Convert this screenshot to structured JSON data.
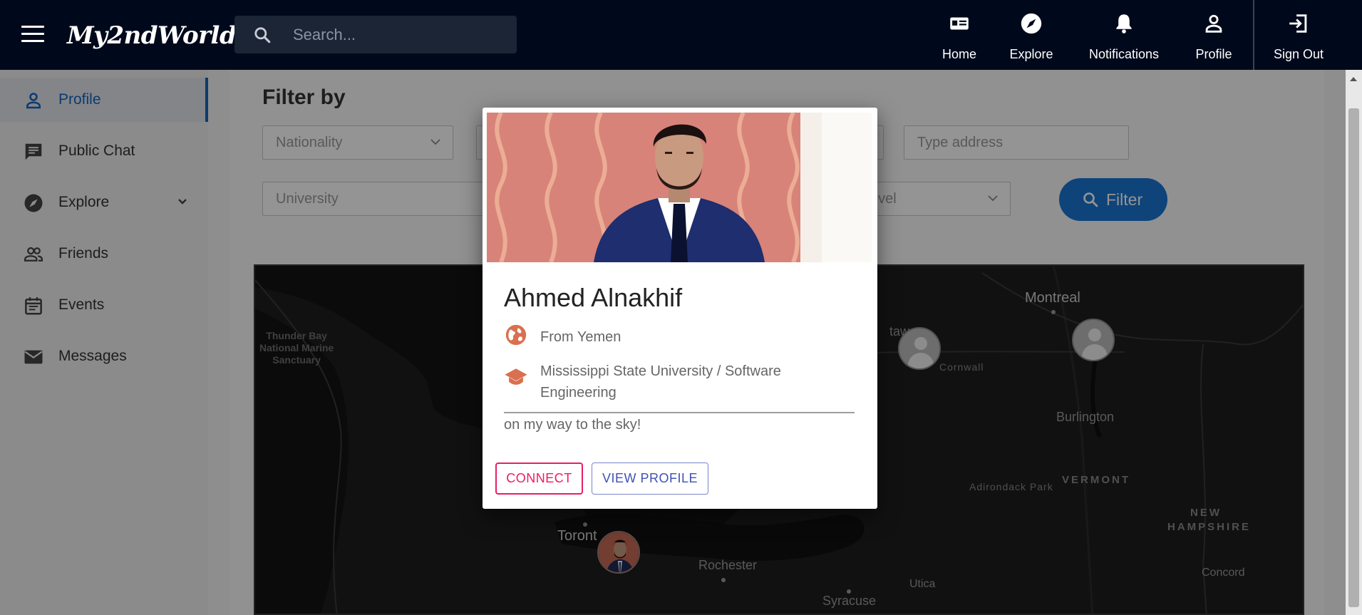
{
  "header": {
    "logo": "My2ndWorld",
    "search_placeholder": "Search...",
    "nav": [
      {
        "label": "Home",
        "icon": "id-card-icon"
      },
      {
        "label": "Explore",
        "icon": "compass-icon"
      },
      {
        "label": "Notifications",
        "icon": "bell-icon"
      },
      {
        "label": "Profile",
        "icon": "person-icon"
      },
      {
        "label": "Sign Out",
        "icon": "exit-icon"
      }
    ]
  },
  "sidebar": {
    "items": [
      {
        "label": "Profile",
        "icon": "person-icon",
        "active": true
      },
      {
        "label": "Public Chat",
        "icon": "chat-icon"
      },
      {
        "label": "Explore",
        "icon": "compass-icon",
        "expandable": true
      },
      {
        "label": "Friends",
        "icon": "group-icon"
      },
      {
        "label": "Events",
        "icon": "calendar-icon"
      },
      {
        "label": "Messages",
        "icon": "mail-icon"
      }
    ]
  },
  "filter": {
    "title": "Filter by",
    "nationality_placeholder": "Nationality",
    "address_placeholder": "Type address",
    "university_placeholder": "University",
    "level_partial": "evel",
    "button_label": "Filter"
  },
  "map": {
    "labels": {
      "montreal": "Montreal",
      "ottawa_partial": "tawa",
      "cornwall": "Cornwall",
      "burlington": "Burlington",
      "adirondack": "Adirondack Park",
      "vermont": "VERMONT",
      "new_hampshire_1": "NEW",
      "new_hampshire_2": "HAMPSHIRE",
      "concord": "Concord",
      "toronto": "Toront",
      "rochester": "Rochester",
      "utica": "Utica",
      "syracuse": "Syracuse",
      "thunder_bay_1": "Thunder Bay",
      "thunder_bay_2": "National Marine",
      "thunder_bay_3": "Sanctuary"
    }
  },
  "profile_card": {
    "name": "Ahmed Alnakhif",
    "nationality": "From Yemen",
    "education": "Mississippi State University / Software Engineering",
    "bio": "on my way to the sky!",
    "connect_label": "CONNECT",
    "view_profile_label": "VIEW PROFILE"
  },
  "colors": {
    "topbar": "#00091b",
    "accent": "#1976d2",
    "connect": "#e91e63",
    "view_profile": "#3f51b5",
    "info_icon": "#d9704f"
  }
}
